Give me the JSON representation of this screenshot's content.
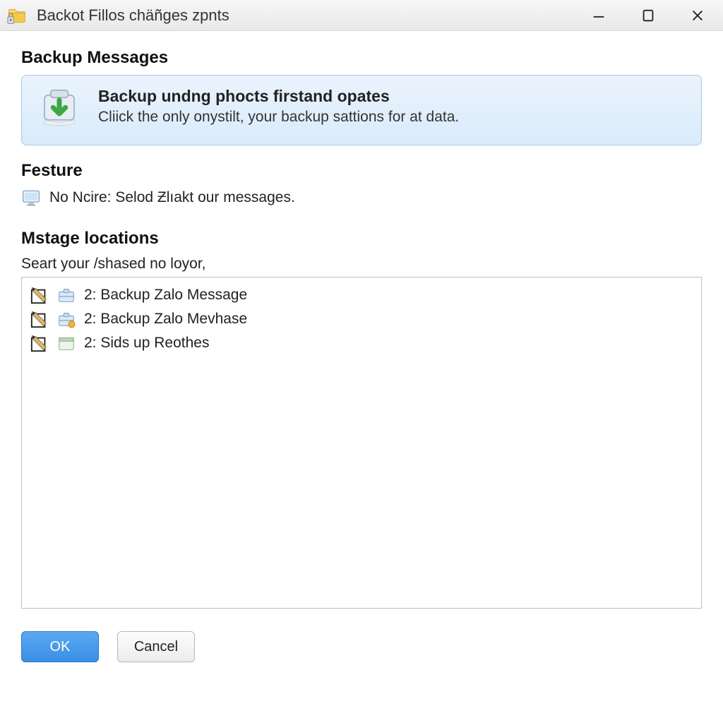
{
  "window": {
    "title": "Backot Fillos chäñges zpnts"
  },
  "sections": {
    "backup_messages": "Backup Messages",
    "feature": "Festure",
    "locations": "Mstage locations"
  },
  "banner": {
    "title": "Backup undng phocts firstand opates",
    "subtitle": "Cliick the only onystilt, your backup sattions for at data."
  },
  "feature_line": "No Ncire: Selod Ƶlıakt our messages.",
  "locations_hint": "Seart your /shased no loyor,",
  "location_items": [
    {
      "label": "2: Backup Zalo Message"
    },
    {
      "label": "2: Backup Zalo Mevhase"
    },
    {
      "label": "2: Sids up Reothes"
    }
  ],
  "buttons": {
    "ok": "OK",
    "cancel": "Cancel"
  }
}
